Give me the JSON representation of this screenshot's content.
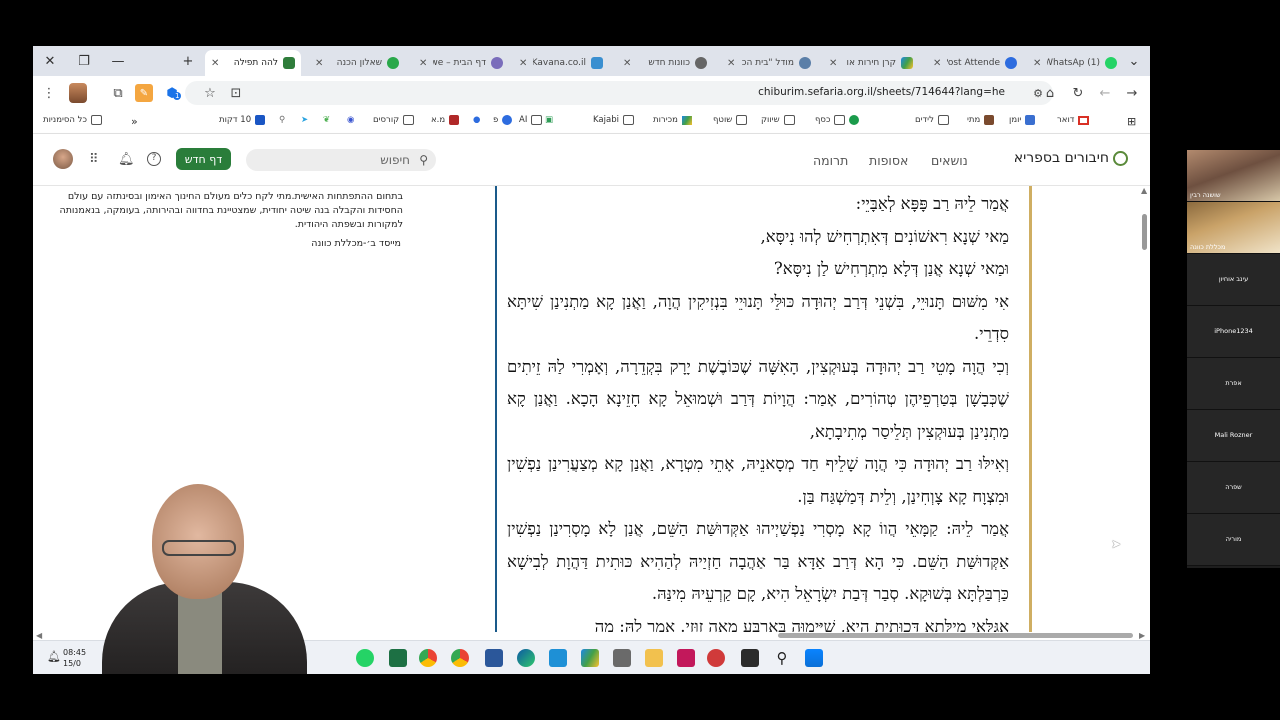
{
  "browser": {
    "tabs": [
      {
        "title": "להה תפילה",
        "active": true
      },
      {
        "title": "שאלון הכנה"
      },
      {
        "title": "דף הבית – we"
      },
      {
        "title": "Kavana.co.il"
      },
      {
        "title": "כוונות חדש"
      },
      {
        "title": "מודל \"בית הכ"
      },
      {
        "title": "קרן חירות או"
      },
      {
        "title": "Post Attende"
      },
      {
        "title": "(1) WhatsAp"
      }
    ],
    "url": "chiburim.sefaria.org.il/sheets/714644?lang=he",
    "extension_badge": "1",
    "bookmarks": [
      "כל הסימניות",
      "10 דקות",
      "קורסים",
      "מ.א",
      "פ",
      "AI",
      "Kajabi",
      "מכירות",
      "שוטף",
      "שיווק",
      "כסף",
      "לידים",
      "מתי",
      "יומן",
      "דואר"
    ]
  },
  "site": {
    "logo": "חיבורים בספריא",
    "nav": [
      "נושאים",
      "אסופות",
      "תרומה"
    ],
    "search_placeholder": "חיפוש",
    "new_sheet": "דף חדש"
  },
  "sidebar": {
    "bio": "בתחום ההתפתחות האישית.מתי לקח כלים מעולם החינוך האימון ובסינתזה עם עולם החסידות והקבלה בנה שיטה יחודית, שמצטיינת בחדווה ובהירותה, בעומקה, בנאמנותה למקורות ובשפתה היהודית.",
    "founder": "מייסד ב׳-מכללת כוונה"
  },
  "text_paragraphs": [
    "אֲמַר לֵיהּ רַב פָּפָּא לְאַבָּיֵי:",
    "מַאי שְׁנָא רִאשׁוֹנִים דְּאִתְרְחִישׁ לְהוּ נִיסָּא,",
    "וּמַאי שְׁנָא אֲנַן דְּלָא מִתְרְחִישׁ לַן נִיסָּא?",
    "אִי מִשּׁוּם תָּנוּיֵי, בִּשְׁנֵי דְּרַב יְהוּדָה כּוּלֵּי תָּנוּיֵי בִּנְזִיקִין הֲוָה, וַאֲנַן קָא מַתְנִינַן שִׁיתָּא סִדְרֵי.",
    "וְכִי הֲוָה מָטֵי רַב יְהוּדָה בְּעוּקְצִין, הָאִשָּׁה שֶׁכּוֹבֶשֶׁת יָרָק בִּקְדֵרָה, וְאָמְרִי לַהּ זֵיתִים שֶׁכְּבָשָׁן בְּטַרְפֵיהֶן טְהוֹרִים, אָמַר: הֲוָיוֹת דְּרַב וּשְׁמוּאֵל קָא חָזֵינָא הָכָא. וַאֲנַן קָא מַתְנִינַן בְּעוּקְצִין תְּלֵיסַר מְתִיבָתָא,",
    "וְאִילּוּ רַב יְהוּדָה כִּי הֲוָה שָׁלֵיף חַד מְסָאנֵיהּ, אָתֵי מִטְרָא, וַאֲנַן קָא מְצַעֲרִינַן נַפְשִׁין וּמִצְוָח קָא צָוְחִינַן, וְלֵית דְּמַשְׁגַּח בַּן.",
    "אֲמַר לֵיהּ: קַמָּאֵי הֲווֹ קָא מָסְרִי נַפְשַׁיְיהוּ אַקְּדוּשַּׁת הַשֵּׁם, אֲנַן לָא מָסְרִינַן נַפְשִׁין אַקְּדוּשַּׁת הַשֵּׁם. כִּי הָא דְּרַב אַדָּא בַּר אַהֲבָה חַזְיַיהּ לְהַהִיא כּוּתִית דַּהֲוָת לְבִישָׁא כַּרְבַּלְתָּא בְּשׁוּקָא. סְבַר דְּבַת יִשְׂרָאֵל הִיא, קָם קַרְעֵיהּ מִינַּהּ.",
    "אִגַּלַּאי מִילְּתָא דְּכוּתִית הִיא, שַׁיְּימוּהָ בְּאַרְבַּע מְאָה זוּזֵי. אֲמַר לַהּ: מָה"
  ],
  "taskbar": {
    "time": "08:45",
    "date": "15/0"
  },
  "zoom": {
    "participants": [
      {
        "name": "שושנה רבין",
        "video": true
      },
      {
        "name": "מכללת כוונה",
        "video": true
      },
      {
        "name": "עינב אוחיון"
      },
      {
        "name": "iPhone1234"
      },
      {
        "name": "אפרת"
      },
      {
        "name": "Mali Rozner"
      },
      {
        "name": "שפרה"
      },
      {
        "name": "מוריה"
      }
    ]
  }
}
